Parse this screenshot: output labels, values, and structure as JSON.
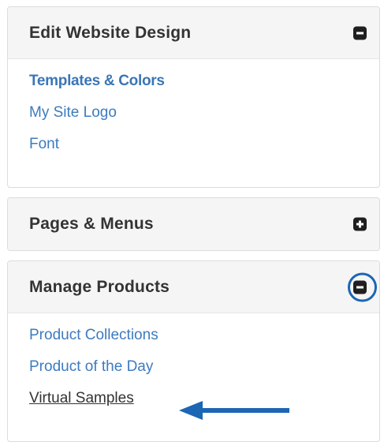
{
  "panels": [
    {
      "title": "Edit Website Design",
      "state": "expanded",
      "toggle_icon": "minus-square-icon",
      "links": [
        "Templates & Colors",
        "My Site Logo",
        "Font"
      ]
    },
    {
      "title": "Pages & Menus",
      "state": "collapsed",
      "toggle_icon": "plus-square-icon"
    },
    {
      "title": "Manage Products",
      "state": "expanded",
      "toggle_icon": "minus-square-icon",
      "toggle_highlighted": true,
      "links": [
        "Product Collections",
        "Product of the Day",
        "Virtual Samples"
      ],
      "active_link": "Virtual Samples"
    }
  ],
  "annotation": {
    "icon": "left-arrow-icon",
    "color": "#1c66b4"
  },
  "colors": {
    "link": "#3d7bbf",
    "header_bg": "#f5f5f5",
    "title": "#333333"
  }
}
